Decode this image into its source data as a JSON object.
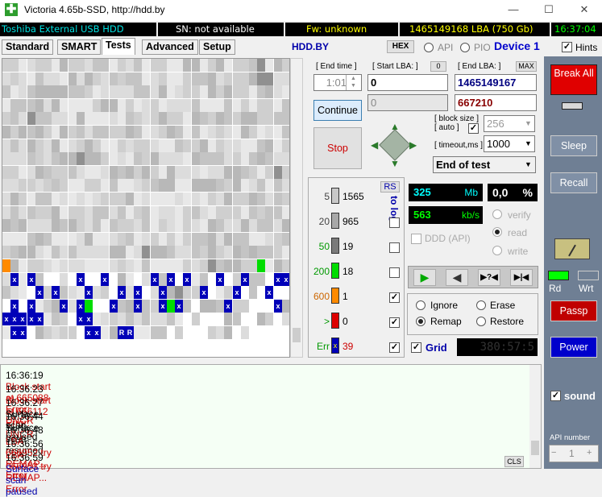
{
  "window": {
    "title": "Victoria 4.65b-SSD, http://hdd.by",
    "minimize": "—",
    "maximize": "☐",
    "close": "✕"
  },
  "infobar": {
    "model": "Toshiba External USB HDD",
    "sn": "SN: not available",
    "fw": "Fw: unknown",
    "lba": "1465149168 LBA (750 Gb)",
    "clock": "16:37:04"
  },
  "tabs": [
    "Standard",
    "SMART",
    "Tests",
    "Advanced",
    "Setup"
  ],
  "header": {
    "site": "HDD.BY",
    "hex": "HEX",
    "api": "API",
    "pio": "PIO",
    "device": "Device 1",
    "hints": "Hints"
  },
  "controls": {
    "end_time_label": "[ End time ]",
    "end_time": "1:01",
    "start_lba_label": "[ Start LBA: ]",
    "start_lba_btn": "0",
    "start_lba": "0",
    "end_lba_label": "[ End LBA: ]",
    "end_lba_btn": "MAX",
    "end_lba": "1465149167",
    "current_left": "0",
    "current_right": "667210",
    "continue": "Continue",
    "stop": "Stop",
    "block_size_label": "[ block size ]",
    "block_auto_label": "[ auto ]",
    "block_size": "256",
    "timeout_label": "[ timeout,ms ]",
    "timeout": "1000",
    "end_action": "End of test",
    "break_all": "Break All"
  },
  "legend": {
    "rs": "RS",
    "to_log": "to log:",
    "rows": [
      {
        "threshold": "5",
        "count": "1565",
        "color": "#c8c8c8",
        "checked": false
      },
      {
        "threshold": "20",
        "count": "965",
        "color": "#a8a8a8",
        "checked": false
      },
      {
        "threshold": "50",
        "count": "19",
        "color": "#7a7a7a",
        "checked": false
      },
      {
        "threshold": "200",
        "count": "18",
        "color": "#00dd00",
        "checked": false
      },
      {
        "threshold": "600",
        "count": "1",
        "color": "#ff8a00",
        "checked": true
      },
      {
        "threshold": ">",
        "count": "0",
        "color": "#dd0000",
        "checked": true
      },
      {
        "threshold": "Err",
        "count": "39",
        "color": "#0000b8",
        "checked": true
      }
    ]
  },
  "stats": {
    "mb": "325",
    "mb_unit": "Mb",
    "percent": "0,0",
    "percent_unit": "%",
    "speed": "563",
    "speed_unit": "kb/s",
    "ddd": "DDD (API)",
    "verify": "verify",
    "read": "read",
    "write": "write"
  },
  "actions": {
    "ignore": "Ignore",
    "erase": "Erase",
    "remap": "Remap",
    "restore": "Restore",
    "grid": "Grid",
    "timer": "380:57:5"
  },
  "right": {
    "sleep": "Sleep",
    "recall": "Recall",
    "rd": "Rd",
    "wrt": "Wrt",
    "passp": "Passp",
    "power": "Power",
    "sound": "sound",
    "api_number_label": "API number",
    "api_number": "1"
  },
  "log": {
    "cls": "CLS",
    "entries": [
      {
        "time": "16:36:19",
        "text": "Block start at 665088 Error: UNCR",
        "color": "#cc0000"
      },
      {
        "time": "16:36:23",
        "text": "Block start at 666112 Error: UNCR",
        "color": "#cc0000"
      },
      {
        "time": "16:36:27",
        "text": "Surface scan paused",
        "color": "#000000"
      },
      {
        "time": "16:36:44",
        "text": "Surface scan resumed",
        "color": "#000000"
      },
      {
        "time": "16:36:48",
        "text": "LBA 666952 try REMAP... Error",
        "color": "#cc0000"
      },
      {
        "time": "16:36:56",
        "text": "LBA 666953 try REMAP... Error",
        "color": "#cc0000"
      },
      {
        "time": "16:36:59",
        "text": "Surface scan paused",
        "color": "#0000aa"
      }
    ]
  },
  "grid_marks": {
    "error_symbol": "x",
    "remap_symbol": "R"
  }
}
